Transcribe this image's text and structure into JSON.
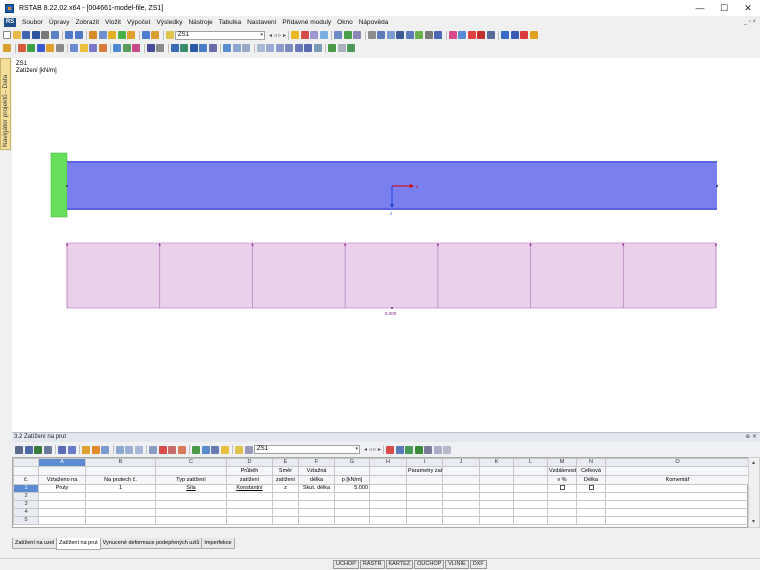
{
  "window": {
    "title": "RSTAB 8.22.02 x64 - [004661-model-file, ZS1]",
    "minimize_glyph": "—",
    "maximize_glyph": "☐",
    "close_glyph": "✕"
  },
  "menu": {
    "logo": "RS",
    "items": [
      "Soubor",
      "Úpravy",
      "Zobrazit",
      "Vložit",
      "Výpočet",
      "Výsledky",
      "Nástroje",
      "Tabulka",
      "Nastavení",
      "Přídavné moduly",
      "Okno",
      "Nápověda"
    ],
    "right_controls": "_ ▫ ×"
  },
  "toolbar": {
    "load_case_value": "ZS1",
    "load_case_arrow": "▾",
    "nav_glyphs": "◂ ◃ ▹ ▸"
  },
  "navigator": {
    "tab_label": "Navigátor projektů - Data"
  },
  "canvas": {
    "load_case": "ZS1",
    "load_unit": "Zatížení [kN/m]",
    "axis_x": "x",
    "axis_z": "z",
    "load_value_label": "5.000"
  },
  "panel": {
    "title": "3.2 Zatížení na prut",
    "title_controls": "⊕ ✕",
    "load_case_value": "ZS1",
    "column_letters": [
      "",
      "A",
      "B",
      "C",
      "D",
      "E",
      "F",
      "G",
      "H",
      "I",
      "J",
      "K",
      "L",
      "M",
      "N",
      "O"
    ],
    "header_row1": [
      "",
      "",
      "",
      "",
      "Průběh",
      "Směr",
      "Vztažná",
      "",
      "",
      "Parametry zatížení na prut",
      "",
      "",
      "",
      "Vzdálenost",
      "Celková",
      ""
    ],
    "header_row2": [
      "č.",
      "Vztaženo na",
      "Na prutech č.",
      "Typ zatížení",
      "zatížení",
      "zatížení",
      "délka",
      "p [kN/m]",
      "",
      "",
      "",
      "",
      "",
      "v %",
      "Délka",
      "Komentář"
    ],
    "rows": [
      [
        "1",
        "Pruty",
        "1",
        "Síla",
        "Konstantní",
        "z",
        "Skut. délka",
        "5.000",
        "",
        "",
        "",
        "",
        "",
        "☐",
        "☐",
        ""
      ],
      [
        "2",
        "",
        "",
        "",
        "",
        "",
        "",
        "",
        "",
        "",
        "",
        "",
        "",
        "",
        "",
        ""
      ],
      [
        "3",
        "",
        "",
        "",
        "",
        "",
        "",
        "",
        "",
        "",
        "",
        "",
        "",
        "",
        "",
        ""
      ],
      [
        "4",
        "",
        "",
        "",
        "",
        "",
        "",
        "",
        "",
        "",
        "",
        "",
        "",
        "",
        "",
        ""
      ],
      [
        "5",
        "",
        "",
        "",
        "",
        "",
        "",
        "",
        "",
        "",
        "",
        "",
        "",
        "",
        "",
        ""
      ]
    ],
    "scroll_up": "▴",
    "scroll_down": "▾"
  },
  "sheet_tabs": [
    "Zatížení na uzel",
    "Zatížení na prut",
    "Vynucené deformace podepřených uzlů",
    "Imperfekce"
  ],
  "status_buttons": [
    "UCHOP",
    "RASTR",
    "KARTEZ",
    "OUCHOP",
    "VLINIE",
    "DXF"
  ],
  "colors": {
    "member_fill": "#7a7ff0",
    "member_edge": "#4a4fd8",
    "support": "#66e05a",
    "load_fill": "#ead0ea",
    "load_stroke": "#b27ab8",
    "load_marker": "#8a1a8a",
    "axis_x": "#e00000",
    "axis_z": "#1a3fd8"
  }
}
